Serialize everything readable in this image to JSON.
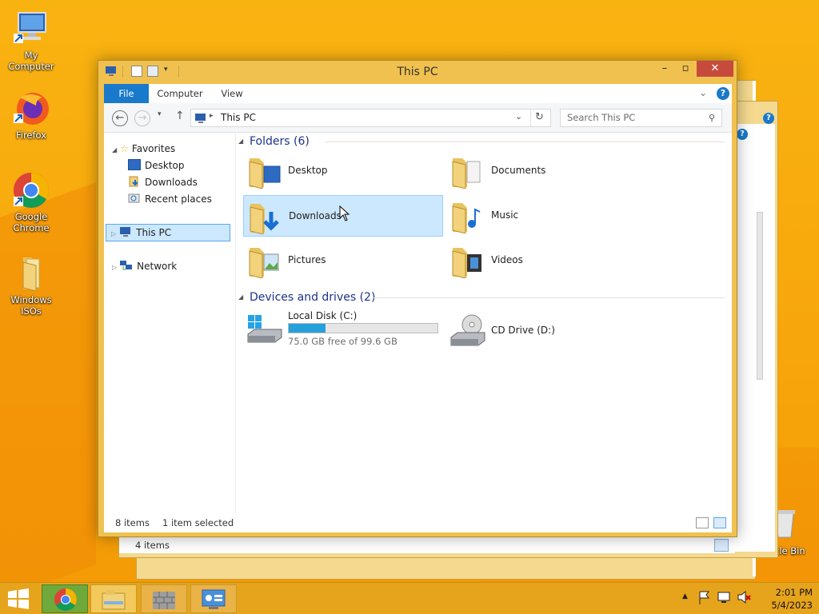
{
  "desktop": {
    "icons": [
      {
        "label": "My Computer"
      },
      {
        "label": "Firefox"
      },
      {
        "label": "Google Chrome"
      },
      {
        "label": "Windows ISOs"
      },
      {
        "label": "cle Bin"
      }
    ]
  },
  "back_window": {
    "status_items": "4 items"
  },
  "window": {
    "title": "This PC",
    "ribbon_tabs": [
      "File",
      "Computer",
      "View"
    ],
    "address": "This PC",
    "search_placeholder": "Search This PC",
    "nav": {
      "favorites": "Favorites",
      "desktop": "Desktop",
      "downloads": "Downloads",
      "recent": "Recent places",
      "this_pc": "This PC",
      "network": "Network"
    },
    "folders_header": "Folders (6)",
    "folders": [
      {
        "label": "Desktop",
        "icon": "desktop-folder-icon"
      },
      {
        "label": "Documents",
        "icon": "documents-folder-icon"
      },
      {
        "label": "Downloads",
        "icon": "downloads-folder-icon",
        "selected": true
      },
      {
        "label": "Music",
        "icon": "music-folder-icon"
      },
      {
        "label": "Pictures",
        "icon": "pictures-folder-icon"
      },
      {
        "label": "Videos",
        "icon": "videos-folder-icon"
      }
    ],
    "devices_header": "Devices and drives (2)",
    "drives": [
      {
        "label": "Local Disk (C:)",
        "free_text": "75.0 GB free of 99.6 GB",
        "used_fraction": 0.247
      },
      {
        "label": "CD Drive (D:)"
      }
    ],
    "status": {
      "items": "8 items",
      "selected": "1 item selected"
    }
  },
  "taskbar": {
    "time": "2:01 PM",
    "date": "5/4/2023"
  },
  "colors": {
    "accent": "#1979ca",
    "window_frame": "#f0c14e",
    "close": "#c74b3d",
    "selection": "#cce8ff",
    "group_header": "#1e3287",
    "drive_bar": "#26a0da"
  }
}
